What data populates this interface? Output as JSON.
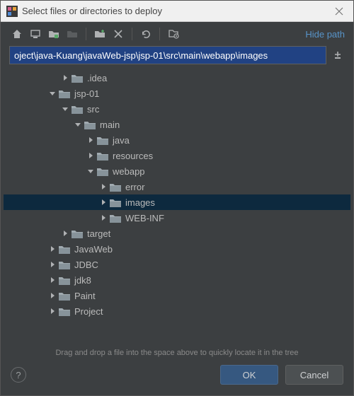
{
  "title": "Select files or directories to deploy",
  "toolbar": {
    "hide_path": "Hide path"
  },
  "path_value": "oject\\java-Kuang\\javaWeb-jsp\\jsp-01\\src\\main\\webapp\\images",
  "tree": [
    {
      "label": ".idea",
      "depth": 4,
      "expanded": false,
      "selected": false
    },
    {
      "label": "jsp-01",
      "depth": 3,
      "expanded": true,
      "selected": false
    },
    {
      "label": "src",
      "depth": 4,
      "expanded": true,
      "selected": false
    },
    {
      "label": "main",
      "depth": 5,
      "expanded": true,
      "selected": false
    },
    {
      "label": "java",
      "depth": 6,
      "expanded": false,
      "selected": false
    },
    {
      "label": "resources",
      "depth": 6,
      "expanded": false,
      "selected": false
    },
    {
      "label": "webapp",
      "depth": 6,
      "expanded": true,
      "selected": false
    },
    {
      "label": "error",
      "depth": 7,
      "expanded": false,
      "selected": false
    },
    {
      "label": "images",
      "depth": 7,
      "expanded": false,
      "selected": true
    },
    {
      "label": "WEB-INF",
      "depth": 7,
      "expanded": false,
      "selected": false
    },
    {
      "label": "target",
      "depth": 4,
      "expanded": false,
      "selected": false
    },
    {
      "label": "JavaWeb",
      "depth": 3,
      "expanded": false,
      "selected": false
    },
    {
      "label": "JDBC",
      "depth": 3,
      "expanded": false,
      "selected": false
    },
    {
      "label": "jdk8",
      "depth": 3,
      "expanded": false,
      "selected": false
    },
    {
      "label": "Paint",
      "depth": 3,
      "expanded": false,
      "selected": false
    },
    {
      "label": "Project",
      "depth": 3,
      "expanded": false,
      "selected": false
    }
  ],
  "hint": "Drag and drop a file into the space above to quickly locate it in the tree",
  "buttons": {
    "ok": "OK",
    "cancel": "Cancel"
  }
}
